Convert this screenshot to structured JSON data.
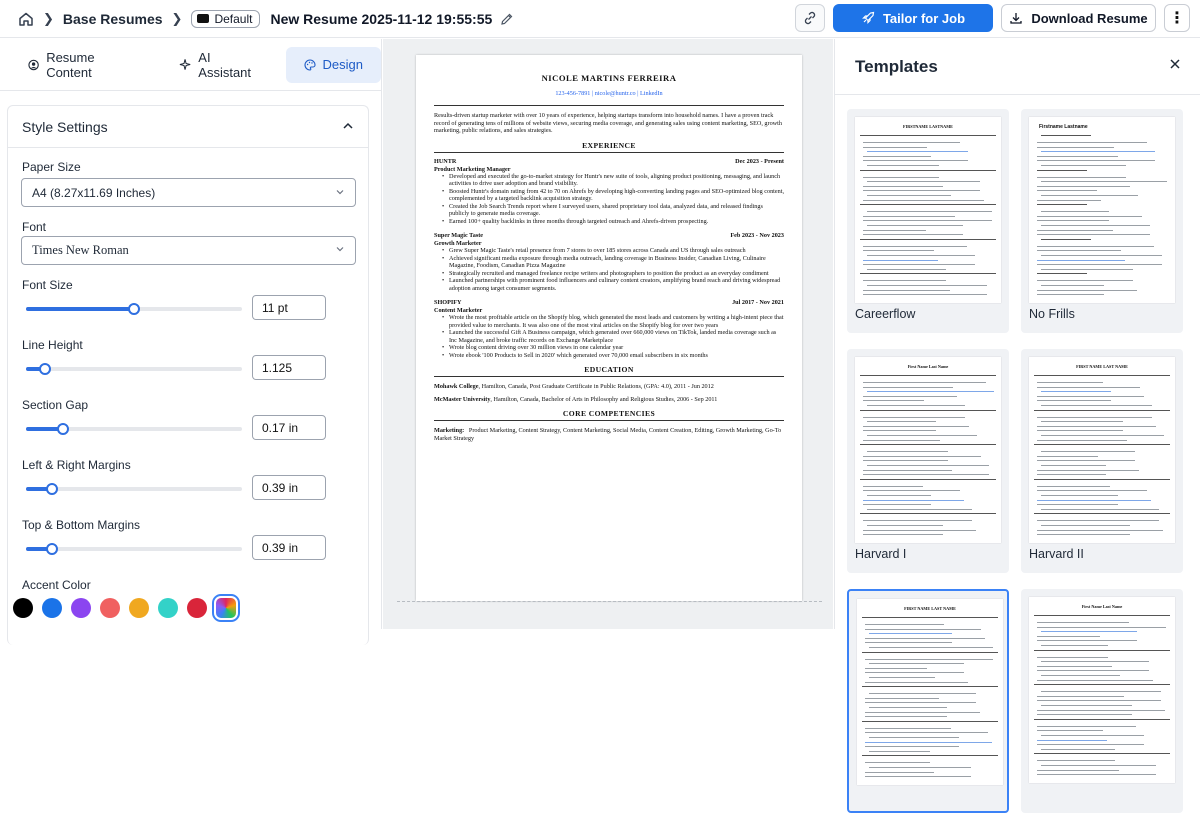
{
  "breadcrumb": {
    "base": "Base Resumes",
    "badge": "Default",
    "title": "New Resume 2025-11-12 19:55:55"
  },
  "actions": {
    "tailor": "Tailor for Job",
    "download": "Download Resume"
  },
  "tabs": [
    {
      "label": "Resume Content"
    },
    {
      "label": "AI Assistant"
    },
    {
      "label": "Design"
    }
  ],
  "style": {
    "title": "Style Settings",
    "paper_size": {
      "label": "Paper Size",
      "value": "A4 (8.27x11.69 Inches)"
    },
    "font": {
      "label": "Font",
      "value": "Times New Roman"
    },
    "font_size": {
      "label": "Font Size",
      "value": "11 pt",
      "level": 0.5
    },
    "line_height": {
      "label": "Line Height",
      "value": "1.125",
      "level": 0.09
    },
    "section_gap": {
      "label": "Section Gap",
      "value": "0.17 in",
      "level": 0.17
    },
    "lr_margins": {
      "label": "Left & Right Margins",
      "value": "0.39 in",
      "level": 0.12
    },
    "tb_margins": {
      "label": "Top & Bottom Margins",
      "value": "0.39 in",
      "level": 0.12
    },
    "accent": {
      "label": "Accent Color",
      "colors": [
        "#000000",
        "#1a73e8",
        "#8b45f0",
        "#f06060",
        "#f0a820",
        "#33d2c8",
        "#d9253a"
      ]
    }
  },
  "resume": {
    "name": "NICOLE MARTINS FERREIRA",
    "contact": "123-456-7891 | nicole@huntr.co | LinkedIn",
    "summary": "Results-driven startup marketer with over 10 years of experience, helping startups transform into household names. I have a proven track record of generating tens of millions of website views, securing media coverage, and generating sales using content marketing, SEO, growth marketing, public relations, and sales strategies.",
    "exp_title": "EXPERIENCE",
    "jobs": [
      {
        "company": "HUNTR",
        "dates": "Dec 2023 - Present",
        "role": "Product Marketing Manager",
        "bullets": [
          "Developed and executed the go-to-market strategy for Huntr's new suite of tools, aligning product positioning, messaging, and launch activities to drive user adoption and brand visibility.",
          "Boosted Huntr's domain rating from 42 to 70 on Ahrefs by developing high-converting landing pages and SEO-optimized blog content, complemented by a targeted backlink acquisition strategy.",
          "Created the Job Search Trends report where I surveyed users, shared proprietary tool data, analyzed data, and released findings publicly to generate media coverage.",
          "Earned 100+ quality backlinks in three months through targeted outreach and Ahrefs-driven prospecting."
        ]
      },
      {
        "company": "Super Magic Taste",
        "dates": "Feb 2023 - Nov 2023",
        "role": "Growth Marketer",
        "bullets": [
          "Grew Super Magic Taste's retail presence from 7 stores to over 185 stores across Canada and US through sales outreach",
          "Achieved significant media exposure through media outreach, landing coverage in Business Insider, Canadian Living, Culinaire Magazine, Foodism, Canadian Pizza Magazine",
          "Strategically recruited and managed freelance recipe writers and photographers to position the product as an everyday condiment",
          "Launched partnerships with prominent food influencers and culinary content creators, amplifying brand reach and driving widespread adoption among target consumer segments."
        ]
      },
      {
        "company": "SHOPIFY",
        "dates": "Jul 2017 - Nov 2021",
        "role": "Content Marketer",
        "bullets": [
          "Wrote the most profitable article on the Shopify blog, which generated the most leads and customers by writing a high-intent piece that provided value to merchants. It was also one of the most viral articles on the Shopify blog for over two years",
          "Launched the successful Gift A Business campaign, which generated over 660,000 views on TikTok, landed media coverage such as Inc Magazine, and broke traffic records on Exchange Marketplace",
          "Wrote blog content driving over 30 million views in one calendar year",
          "Wrote ebook '100 Products to Sell in 2020' which generated over 70,000 email subscribers in six months"
        ]
      }
    ],
    "edu_title": "EDUCATION",
    "edu": [
      {
        "school": "Mohawk College",
        "text": ", Hamilton, Canada, Post Graduate Certificate in Public Relations, (GPA: 4.0), 2011 - Jun 2012"
      },
      {
        "school": "McMaster University",
        "text": ", Hamilton, Canada, Bachelor of Arts in Philosophy and Religious Studies, 2006 - Sep 2011"
      }
    ],
    "comp_title": "CORE COMPETENCIES",
    "comp_label": "Marketing:",
    "comp_text": "Product Marketing, Content Strategy, Content Marketing, Social Media, Content Creation, Editing, Growth Marketing, Go-To Market Strategy"
  },
  "templates": {
    "title": "Templates",
    "items": [
      {
        "label": "Careerflow",
        "thumb_title": "FIRSTNAME LASTNAME"
      },
      {
        "label": "No Frills",
        "thumb_title": "Firstname Lastname"
      },
      {
        "label": "Harvard I",
        "thumb_title": "First Name Last Name"
      },
      {
        "label": "Harvard II",
        "thumb_title": "FIRST NAME LAST NAME"
      },
      {
        "label": "",
        "thumb_title": "FIRST NAME LAST NAME"
      },
      {
        "label": "",
        "thumb_title": "First Name Last Name"
      }
    ]
  }
}
